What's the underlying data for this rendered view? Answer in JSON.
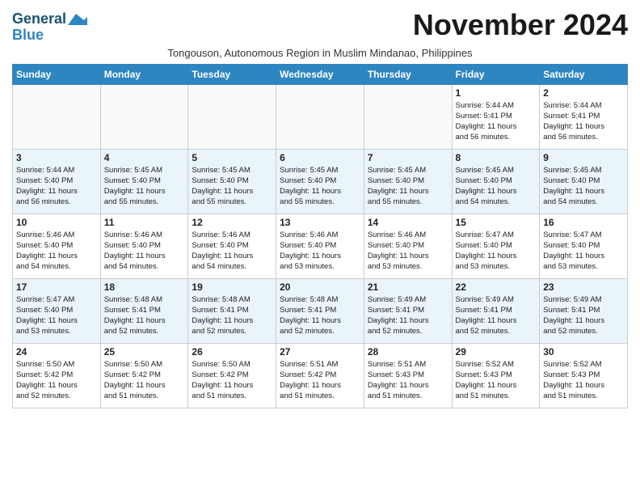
{
  "header": {
    "logo_general": "General",
    "logo_blue": "Blue",
    "month_title": "November 2024",
    "subtitle": "Tongouson, Autonomous Region in Muslim Mindanao, Philippines"
  },
  "weekdays": [
    "Sunday",
    "Monday",
    "Tuesday",
    "Wednesday",
    "Thursday",
    "Friday",
    "Saturday"
  ],
  "weeks": [
    [
      {
        "day": "",
        "text": ""
      },
      {
        "day": "",
        "text": ""
      },
      {
        "day": "",
        "text": ""
      },
      {
        "day": "",
        "text": ""
      },
      {
        "day": "",
        "text": ""
      },
      {
        "day": "1",
        "text": "Sunrise: 5:44 AM\nSunset: 5:41 PM\nDaylight: 11 hours\nand 56 minutes."
      },
      {
        "day": "2",
        "text": "Sunrise: 5:44 AM\nSunset: 5:41 PM\nDaylight: 11 hours\nand 56 minutes."
      }
    ],
    [
      {
        "day": "3",
        "text": "Sunrise: 5:44 AM\nSunset: 5:40 PM\nDaylight: 11 hours\nand 56 minutes."
      },
      {
        "day": "4",
        "text": "Sunrise: 5:45 AM\nSunset: 5:40 PM\nDaylight: 11 hours\nand 55 minutes."
      },
      {
        "day": "5",
        "text": "Sunrise: 5:45 AM\nSunset: 5:40 PM\nDaylight: 11 hours\nand 55 minutes."
      },
      {
        "day": "6",
        "text": "Sunrise: 5:45 AM\nSunset: 5:40 PM\nDaylight: 11 hours\nand 55 minutes."
      },
      {
        "day": "7",
        "text": "Sunrise: 5:45 AM\nSunset: 5:40 PM\nDaylight: 11 hours\nand 55 minutes."
      },
      {
        "day": "8",
        "text": "Sunrise: 5:45 AM\nSunset: 5:40 PM\nDaylight: 11 hours\nand 54 minutes."
      },
      {
        "day": "9",
        "text": "Sunrise: 5:45 AM\nSunset: 5:40 PM\nDaylight: 11 hours\nand 54 minutes."
      }
    ],
    [
      {
        "day": "10",
        "text": "Sunrise: 5:46 AM\nSunset: 5:40 PM\nDaylight: 11 hours\nand 54 minutes."
      },
      {
        "day": "11",
        "text": "Sunrise: 5:46 AM\nSunset: 5:40 PM\nDaylight: 11 hours\nand 54 minutes."
      },
      {
        "day": "12",
        "text": "Sunrise: 5:46 AM\nSunset: 5:40 PM\nDaylight: 11 hours\nand 54 minutes."
      },
      {
        "day": "13",
        "text": "Sunrise: 5:46 AM\nSunset: 5:40 PM\nDaylight: 11 hours\nand 53 minutes."
      },
      {
        "day": "14",
        "text": "Sunrise: 5:46 AM\nSunset: 5:40 PM\nDaylight: 11 hours\nand 53 minutes."
      },
      {
        "day": "15",
        "text": "Sunrise: 5:47 AM\nSunset: 5:40 PM\nDaylight: 11 hours\nand 53 minutes."
      },
      {
        "day": "16",
        "text": "Sunrise: 5:47 AM\nSunset: 5:40 PM\nDaylight: 11 hours\nand 53 minutes."
      }
    ],
    [
      {
        "day": "17",
        "text": "Sunrise: 5:47 AM\nSunset: 5:40 PM\nDaylight: 11 hours\nand 53 minutes."
      },
      {
        "day": "18",
        "text": "Sunrise: 5:48 AM\nSunset: 5:41 PM\nDaylight: 11 hours\nand 52 minutes."
      },
      {
        "day": "19",
        "text": "Sunrise: 5:48 AM\nSunset: 5:41 PM\nDaylight: 11 hours\nand 52 minutes."
      },
      {
        "day": "20",
        "text": "Sunrise: 5:48 AM\nSunset: 5:41 PM\nDaylight: 11 hours\nand 52 minutes."
      },
      {
        "day": "21",
        "text": "Sunrise: 5:49 AM\nSunset: 5:41 PM\nDaylight: 11 hours\nand 52 minutes."
      },
      {
        "day": "22",
        "text": "Sunrise: 5:49 AM\nSunset: 5:41 PM\nDaylight: 11 hours\nand 52 minutes."
      },
      {
        "day": "23",
        "text": "Sunrise: 5:49 AM\nSunset: 5:41 PM\nDaylight: 11 hours\nand 52 minutes."
      }
    ],
    [
      {
        "day": "24",
        "text": "Sunrise: 5:50 AM\nSunset: 5:42 PM\nDaylight: 11 hours\nand 52 minutes."
      },
      {
        "day": "25",
        "text": "Sunrise: 5:50 AM\nSunset: 5:42 PM\nDaylight: 11 hours\nand 51 minutes."
      },
      {
        "day": "26",
        "text": "Sunrise: 5:50 AM\nSunset: 5:42 PM\nDaylight: 11 hours\nand 51 minutes."
      },
      {
        "day": "27",
        "text": "Sunrise: 5:51 AM\nSunset: 5:42 PM\nDaylight: 11 hours\nand 51 minutes."
      },
      {
        "day": "28",
        "text": "Sunrise: 5:51 AM\nSunset: 5:43 PM\nDaylight: 11 hours\nand 51 minutes."
      },
      {
        "day": "29",
        "text": "Sunrise: 5:52 AM\nSunset: 5:43 PM\nDaylight: 11 hours\nand 51 minutes."
      },
      {
        "day": "30",
        "text": "Sunrise: 5:52 AM\nSunset: 5:43 PM\nDaylight: 11 hours\nand 51 minutes."
      }
    ]
  ]
}
